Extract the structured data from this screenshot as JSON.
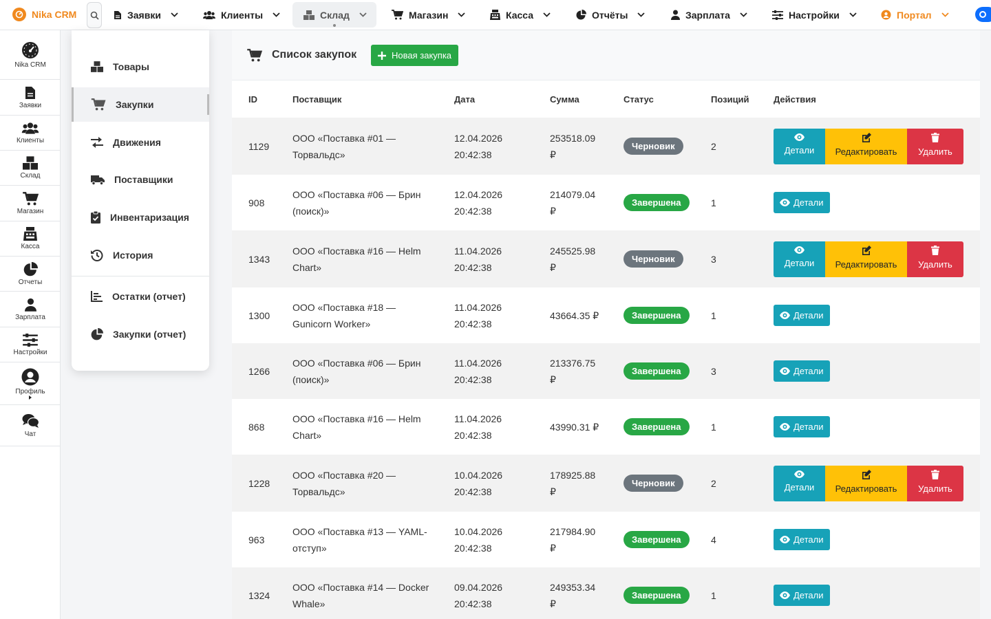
{
  "app": {
    "brand": "Nika CRM"
  },
  "topnav": [
    {
      "label": "Заявки",
      "icon": "file-icon"
    },
    {
      "label": "Клиенты",
      "icon": "users-icon"
    },
    {
      "label": "Склад",
      "icon": "boxes-icon"
    },
    {
      "label": "Магазин",
      "icon": "cart-icon"
    },
    {
      "label": "Касса",
      "icon": "cash-register-icon"
    },
    {
      "label": "Отчёты",
      "icon": "pie-chart-icon"
    },
    {
      "label": "Зарплата",
      "icon": "user-tie-icon"
    },
    {
      "label": "Настройки",
      "icon": "sliders-icon"
    },
    {
      "label": "Портал",
      "icon": "portal-icon"
    }
  ],
  "sidebar": [
    {
      "label": "Nika CRM",
      "icon": "dashboard-icon"
    },
    {
      "label": "Заявки",
      "icon": "file-icon"
    },
    {
      "label": "Клиенты",
      "icon": "users-icon"
    },
    {
      "label": "Склад",
      "icon": "boxes-icon"
    },
    {
      "label": "Магазин",
      "icon": "cart-icon"
    },
    {
      "label": "Касса",
      "icon": "cash-register-icon"
    },
    {
      "label": "Отчеты",
      "icon": "pie-chart-icon"
    },
    {
      "label": "Зарплата",
      "icon": "user-tie-icon"
    },
    {
      "label": "Настройки",
      "icon": "sliders-icon"
    },
    {
      "label": "Профиль",
      "icon": "user-circle-icon"
    },
    {
      "label": "Чат",
      "icon": "chat-icon"
    }
  ],
  "submenu": [
    {
      "label": "Товары",
      "icon": "boxes-icon"
    },
    {
      "label": "Закупки",
      "icon": "cart-icon"
    },
    {
      "label": "Движения",
      "icon": "exchange-icon"
    },
    {
      "label": "Поставщики",
      "icon": "truck-icon"
    },
    {
      "label": "Инвентаризация",
      "icon": "clipboard-check-icon"
    },
    {
      "label": "История",
      "icon": "history-icon"
    },
    {
      "label": "Остатки (отчет)",
      "icon": "chart-bar-icon"
    },
    {
      "label": "Закупки (отчет)",
      "icon": "pie-chart-icon"
    }
  ],
  "page": {
    "title": "Список закупок",
    "new_button": "Новая закупка"
  },
  "table": {
    "headers": [
      "ID",
      "Поставщик",
      "Дата",
      "Сумма",
      "Статус",
      "Позиций",
      "Действия"
    ],
    "actions": {
      "details": "Детали",
      "edit": "Редактировать",
      "delete": "Удалить"
    },
    "rows": [
      {
        "id": "1129",
        "supplier_1": "ООО «Поставка #01 —",
        "supplier_2": "Торвальдс»",
        "date": "12.04.2026",
        "time": "20:42:38",
        "sum_1": "253518.09",
        "sum_2": "₽",
        "status": "Черновик",
        "status_type": "draft",
        "positions": "2"
      },
      {
        "id": "908",
        "supplier_1": "ООО «Поставка #06 — Брин",
        "supplier_2": "(поиск)»",
        "date": "12.04.2026",
        "time": "20:42:38",
        "sum_1": "214079.04",
        "sum_2": "₽",
        "status": "Завершена",
        "status_type": "done",
        "positions": "1"
      },
      {
        "id": "1343",
        "supplier_1": "ООО «Поставка #16 — Helm",
        "supplier_2": "Chart»",
        "date": "11.04.2026",
        "time": "20:42:38",
        "sum_1": "245525.98",
        "sum_2": "₽",
        "status": "Черновик",
        "status_type": "draft",
        "positions": "3"
      },
      {
        "id": "1300",
        "supplier_1": "ООО «Поставка #18 —",
        "supplier_2": "Gunicorn Worker»",
        "date": "11.04.2026",
        "time": "20:42:38",
        "sum_1": "43664.35 ₽",
        "sum_2": "",
        "status": "Завершена",
        "status_type": "done",
        "positions": "1"
      },
      {
        "id": "1266",
        "supplier_1": "ООО «Поставка #06 — Брин",
        "supplier_2": "(поиск)»",
        "date": "11.04.2026",
        "time": "20:42:38",
        "sum_1": "213376.75",
        "sum_2": "₽",
        "status": "Завершена",
        "status_type": "done",
        "positions": "3"
      },
      {
        "id": "868",
        "supplier_1": "ООО «Поставка #16 — Helm",
        "supplier_2": "Chart»",
        "date": "11.04.2026",
        "time": "20:42:38",
        "sum_1": "43990.31 ₽",
        "sum_2": "",
        "status": "Завершена",
        "status_type": "done",
        "positions": "1"
      },
      {
        "id": "1228",
        "supplier_1": "ООО «Поставка #20 —",
        "supplier_2": "Торвальдс»",
        "date": "10.04.2026",
        "time": "20:42:38",
        "sum_1": "178925.88",
        "sum_2": "₽",
        "status": "Черновик",
        "status_type": "draft",
        "positions": "2"
      },
      {
        "id": "963",
        "supplier_1": "ООО «Поставка #13 — YAML-",
        "supplier_2": "отступ»",
        "date": "10.04.2026",
        "time": "20:42:38",
        "sum_1": "217984.90",
        "sum_2": "₽",
        "status": "Завершена",
        "status_type": "done",
        "positions": "4"
      },
      {
        "id": "1324",
        "supplier_1": "ООО «Поставка #14 — Docker",
        "supplier_2": "Whale»",
        "date": "09.04.2026",
        "time": "20:42:38",
        "sum_1": "249353.34",
        "sum_2": "₽",
        "status": "Завершена",
        "status_type": "done",
        "positions": "1"
      }
    ]
  },
  "colors": {
    "brand": "#f0891e",
    "success": "#28a745",
    "secondary": "#6c757d",
    "info": "#17a2b8",
    "warning": "#ffc107",
    "danger": "#dc3545"
  }
}
